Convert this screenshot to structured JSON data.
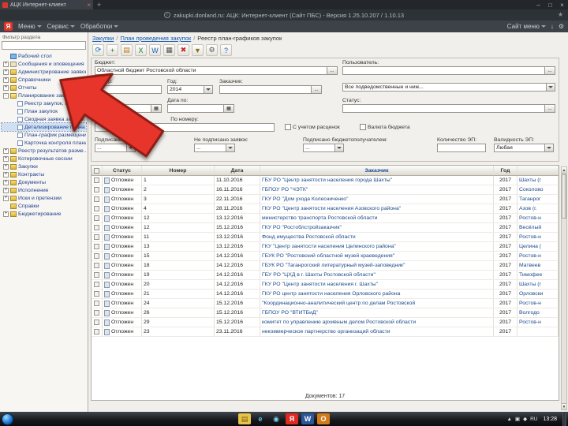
{
  "browser": {
    "tab_title": "АЦК Интернет-клиент",
    "new_tab": "+",
    "address": "zakupki.donland.ru: АЦК: Интернет-клиент (Сайт ПБС) - Версия 1.25.10.207 / 1.10.13",
    "logo": "Я",
    "menu_items": [
      "Меню",
      "Сервис",
      "Обработки"
    ],
    "site_menu": "Сайт меню",
    "window_controls": {
      "minimize": "–",
      "maximize": "□",
      "close": "×"
    }
  },
  "icons": {
    "ellipsis": "...",
    "calendar": "▦",
    "star": "★",
    "gear": "⚙",
    "download": "↓",
    "info": "i",
    "scroll_up": "▲",
    "scroll_down": "▼",
    "tray_expand": "▲",
    "tray_network": "▣",
    "tray_sound": "◆"
  },
  "sidebar": {
    "filter_label": "Фильтр раздела",
    "items": [
      {
        "label": "Рабочий стол",
        "indent": 0,
        "expand": "",
        "icon_type": "desktop"
      },
      {
        "label": "Сообщения и оповещения",
        "indent": 0,
        "expand": "+",
        "icon_type": "mail"
      },
      {
        "label": "Администрирование заявок",
        "indent": 0,
        "expand": "+",
        "icon_type": "folder"
      },
      {
        "label": "Справочники",
        "indent": 0,
        "expand": "+",
        "icon_type": "folder"
      },
      {
        "label": "Отчеты",
        "indent": 0,
        "expand": "+",
        "icon_type": "folder"
      },
      {
        "label": "Планирование закупок",
        "indent": 0,
        "expand": "-",
        "icon_type": "folder-open"
      },
      {
        "label": "Реестр закупок, которые...",
        "indent": 1,
        "expand": "",
        "icon_type": "doc"
      },
      {
        "label": "План закупок",
        "indent": 1,
        "expand": "",
        "icon_type": "doc"
      },
      {
        "label": "Сводная заявка закупок",
        "indent": 1,
        "expand": "",
        "icon_type": "doc"
      },
      {
        "label": "Детализирование плана зак...",
        "indent": 1,
        "expand": "",
        "icon_type": "doc",
        "selected": true
      },
      {
        "label": "План-график размещения з...",
        "indent": 1,
        "expand": "",
        "icon_type": "doc"
      },
      {
        "label": "Карточка контроля планир...",
        "indent": 1,
        "expand": "",
        "icon_type": "doc"
      },
      {
        "label": "Реестр результатов разме...",
        "indent": 0,
        "expand": "+",
        "icon_type": "folder"
      },
      {
        "label": "Котировочные сессии",
        "indent": 0,
        "expand": "+",
        "icon_type": "folder"
      },
      {
        "label": "Закупки",
        "indent": 0,
        "expand": "+",
        "icon_type": "folder"
      },
      {
        "label": "Контракты",
        "indent": 0,
        "expand": "+",
        "icon_type": "folder"
      },
      {
        "label": "Документы",
        "indent": 0,
        "expand": "+",
        "icon_type": "folder"
      },
      {
        "label": "Исполнение",
        "indent": 0,
        "expand": "+",
        "icon_type": "folder"
      },
      {
        "label": "Иски и претензии",
        "indent": 0,
        "expand": "+",
        "icon_type": "folder"
      },
      {
        "label": "Справки",
        "indent": 0,
        "expand": "",
        "icon_type": "folder"
      },
      {
        "label": "Бюджетирование",
        "indent": 0,
        "expand": "+",
        "icon_type": "folder"
      }
    ]
  },
  "breadcrumb": {
    "links": [
      "Закупки",
      "План проведения закупок"
    ],
    "separator": "/",
    "current": "Реестр план-графиков закупок"
  },
  "toolbar": {
    "icons": [
      {
        "name": "refresh",
        "glyph": "⟳",
        "color": "#1565c0"
      },
      {
        "name": "create",
        "glyph": "+",
        "color": "#2e7d32"
      },
      {
        "name": "open",
        "glyph": "▤",
        "color": "#c07c1f"
      },
      {
        "name": "excel",
        "glyph": "X",
        "color": "#1d7a33"
      },
      {
        "name": "word",
        "glyph": "W",
        "color": "#1a5bb5"
      },
      {
        "name": "print",
        "glyph": "▦",
        "color": "#555555"
      },
      {
        "name": "delete",
        "glyph": "✖",
        "color": "#c62828"
      },
      {
        "name": "filter",
        "glyph": "▼",
        "color": "#8a6d1f"
      },
      {
        "name": "settings",
        "glyph": "⚙",
        "color": "#555555"
      },
      {
        "name": "help",
        "glyph": "?",
        "color": "#1565c0"
      }
    ]
  },
  "filters": {
    "budget_label": "Бюджет:",
    "budget_value": "Областной бюджет Ростовской области",
    "user_label": "Пользователь:",
    "user_value": "",
    "number_label": "Номер:",
    "number_value": "",
    "year_label": "Год:",
    "year_value": "2014",
    "customer_label": "Заказчик:",
    "customer_value": "",
    "subordination_value": "Все подведомственные и ниж...",
    "date_from_label": "Дата с:",
    "date_to_label": "Дата по:",
    "status_label": "Статус:",
    "status_value": "",
    "by_number_label": "По номеру:",
    "by_number_value": "",
    "checkbox_rates": "С учетом расценок",
    "checkbox_currency": "Валюта бюджета",
    "signed_label": "Подписано заявок:",
    "not_signed_label": "Не подписано заявок:",
    "signed_recipient_label": "Подписано бюджетополучателем:",
    "ep_count_label": "Количество ЭП:",
    "ep_count_value": "",
    "ep_valid_label": "Валидность ЭП:",
    "ep_valid_value": "Любая"
  },
  "table": {
    "headers": [
      "Статус",
      "Номер",
      "Дата",
      "Заказчик",
      "Год"
    ],
    "rows": [
      {
        "status": "Отложен",
        "number": "1",
        "date": "11.10.2016",
        "customer": "ГБУ РО \"Центр занятости населения города Шахты\"",
        "year": "2017",
        "place": "Шахты (г"
      },
      {
        "status": "Отложен",
        "number": "2",
        "date": "16.11.2016",
        "customer": "ГБПОУ РО \"ЧЭТК\"",
        "year": "2017",
        "place": "Соколово"
      },
      {
        "status": "Отложен",
        "number": "3",
        "date": "22.11.2016",
        "customer": "ГКУ РО \"Дом ухода Колесниченко\"",
        "year": "2017",
        "place": "Таганрог"
      },
      {
        "status": "Отложен",
        "number": "4",
        "date": "28.11.2016",
        "customer": "ГКУ РО \"Центр занятости населения Азовского района\"",
        "year": "2017",
        "place": "Азов (г."
      },
      {
        "status": "Отложен",
        "number": "12",
        "date": "13.12.2016",
        "customer": "министерство транспорта Ростовской области",
        "year": "2017",
        "place": "Ростов-н"
      },
      {
        "status": "Отложен",
        "number": "12",
        "date": "15.12.2016",
        "customer": "ГКУ РО \"Ростоблстройзаказчик\"",
        "year": "2017",
        "place": "Весёлый"
      },
      {
        "status": "Отложен",
        "number": "11",
        "date": "13.12.2016",
        "customer": "Фонд имущества Ростовской области",
        "year": "2017",
        "place": "Ростов-н"
      },
      {
        "status": "Отложен",
        "number": "13",
        "date": "13.12.2016",
        "customer": "ГКУ \"Центр занятости населения Целинского района\"",
        "year": "2017",
        "place": "Целина ("
      },
      {
        "status": "Отложен",
        "number": "15",
        "date": "14.12.2016",
        "customer": "ГБУК РО \"Ростовский областной музей краеведения\"",
        "year": "2017",
        "place": "Ростов-н"
      },
      {
        "status": "Отложен",
        "number": "18",
        "date": "14.12.2016",
        "customer": "ГБУК РО \"Таганрогский литературный музей-заповедник\"",
        "year": "2017",
        "place": "Матвеев"
      },
      {
        "status": "Отложен",
        "number": "19",
        "date": "14.12.2016",
        "customer": "ГБУ РО \"ЦХД в г. Шахты Ростовской области\"",
        "year": "2017",
        "place": "Тимофее"
      },
      {
        "status": "Отложен",
        "number": "20",
        "date": "14.12.2016",
        "customer": "ГКУ РО \"Центр занятости населения г. Шахты\"",
        "year": "2017",
        "place": "Шахты (г"
      },
      {
        "status": "Отложен",
        "number": "21",
        "date": "14.12.2016",
        "customer": "ГКУ РО центр занятости населения Орловского района",
        "year": "2017",
        "place": "Орловски"
      },
      {
        "status": "Отложен",
        "number": "24",
        "date": "15.12.2016",
        "customer": "\"Координационно-аналитический центр по делам Ростовской",
        "year": "2017",
        "place": "Ростов-н"
      },
      {
        "status": "Отложен",
        "number": "26",
        "date": "15.12.2016",
        "customer": "ГБПОУ РО \"ВТИТБиД\"",
        "year": "2017",
        "place": "Волгодо"
      },
      {
        "status": "Отложен",
        "number": "29",
        "date": "15.12.2016",
        "customer": "комитет по управлению архивным делом Ростовской области",
        "year": "2017",
        "place": "Ростов-н"
      },
      {
        "status": "Отложен",
        "number": "23",
        "date": "23.11.2016",
        "customer": "некоммерческое партнерство организаций области",
        "year": "2017",
        "place": ""
      }
    ],
    "footer": "Документов: 17"
  },
  "taskbar": {
    "apps": [
      {
        "name": "explorer-folder",
        "glyph": "▤",
        "bg": "#e8c34a",
        "color": "#7a5b12"
      },
      {
        "name": "internet-explorer",
        "glyph": "e",
        "bg": "transparent",
        "color": "#5ec3f0"
      },
      {
        "name": "media-player",
        "glyph": "◉",
        "bg": "transparent",
        "color": "#7fd0f0"
      },
      {
        "name": "yandex-browser",
        "glyph": "Я",
        "bg": "#e02920",
        "color": "#ffffff"
      },
      {
        "name": "office-word",
        "glyph": "W",
        "bg": "#2b579a",
        "color": "#ffffff"
      },
      {
        "name": "outlook",
        "glyph": "O",
        "bg": "#d07c1a",
        "color": "#ffffff"
      }
    ],
    "lang": "RU",
    "time": "13:28"
  }
}
